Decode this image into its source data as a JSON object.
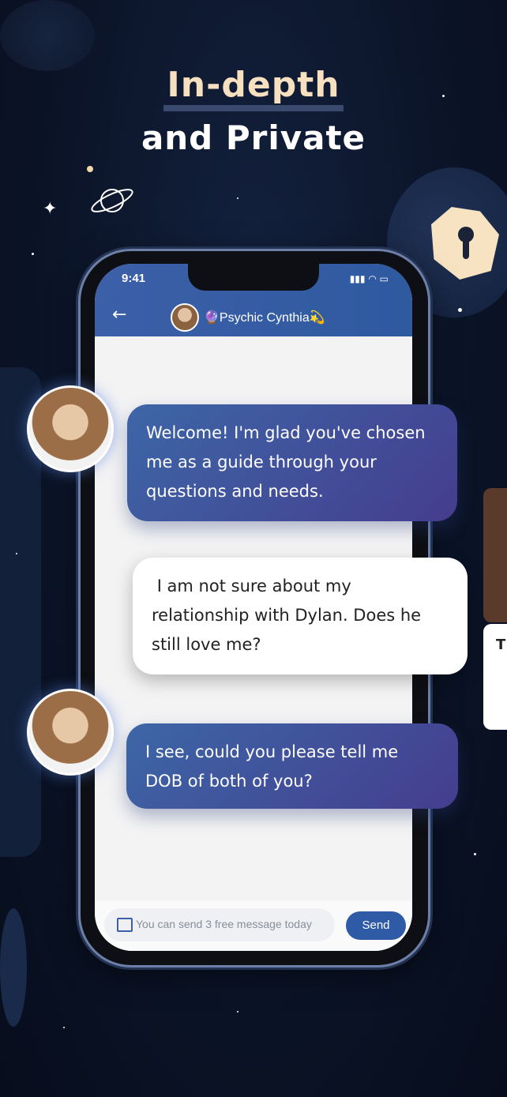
{
  "headline": {
    "line1": "In-depth",
    "line2": "and Private"
  },
  "phone": {
    "status": {
      "time": "9:41"
    },
    "header": {
      "back_icon": "arrow-left-icon",
      "name": "🔮Psychic Cynthia💫"
    },
    "messages": [
      {
        "sender": "psychic",
        "text": "Welcome! I'm glad you've chosen me as a guide through your questions and needs."
      },
      {
        "sender": "user",
        "text": " I am not sure about my relationship with Dylan. Does he still love me?"
      },
      {
        "sender": "psychic",
        "text": "I see, could you please tell me DOB of both of you?"
      }
    ],
    "input": {
      "placeholder": "You can send 3 free message today",
      "send_label": "Send"
    }
  },
  "side_card": {
    "text": "T"
  },
  "colors": {
    "accent": "#2f5aa5",
    "bubble_gradient_start": "#3d66a7",
    "bubble_gradient_end": "#453d8f",
    "headline_cream": "#f7e0c0"
  }
}
